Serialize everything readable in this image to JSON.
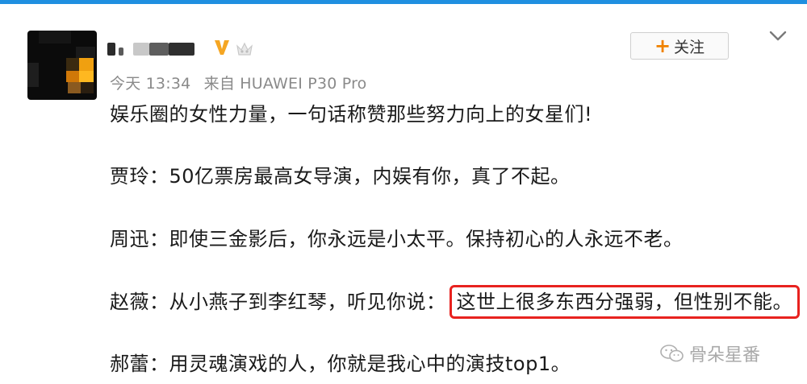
{
  "post": {
    "meta_time": "今天 13:34",
    "meta_source": "来自 HUAWEI P30 Pro",
    "follow_label": "关注",
    "follow_plus": "+",
    "lines": [
      {
        "text": "娱乐圈的女性力量，一句话称赞那些努力向上的女星们!"
      },
      {
        "text": "贾玲：50亿票房最高女导演，内娱有你，真了不起。"
      },
      {
        "text": "周迅：即使三金影后，你永远是小太平。保持初心的人永远不老。"
      },
      {
        "prefix": "赵薇：从小燕子到李红琴，听见你说：",
        "highlight": "这世上很多东西分强弱，但性别不能。"
      },
      {
        "text": "郝蕾：用灵魂演戏的人，你就是我心中的演技top1。"
      }
    ]
  },
  "watermark": {
    "text": "骨朵星番"
  },
  "colors": {
    "accent_top_bar": "#1f8fe0",
    "highlight_border": "#e8221f",
    "plus": "#f08200",
    "vip": "#f5a623"
  },
  "icons": [
    "avatar-pixelated",
    "vip-icon",
    "crown-icon",
    "chevron-down-icon",
    "wechat-icon"
  ]
}
